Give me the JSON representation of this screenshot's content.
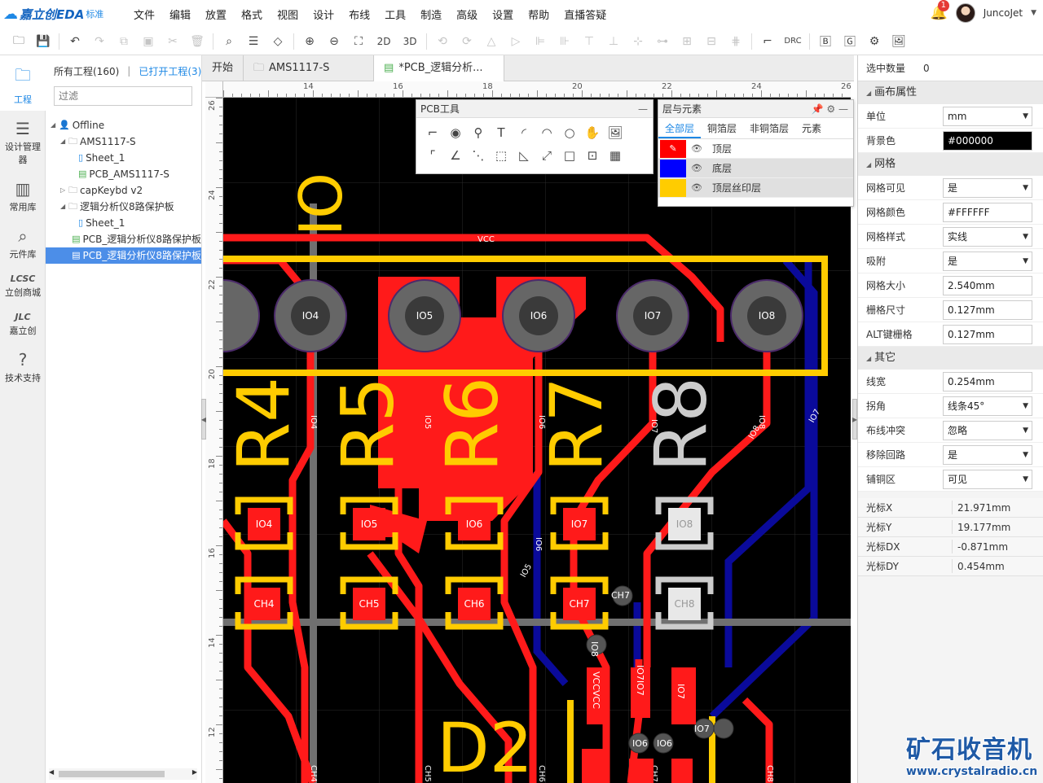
{
  "app": {
    "brand": "嘉立创EDA",
    "edition": "标准"
  },
  "menu": [
    "文件",
    "编辑",
    "放置",
    "格式",
    "视图",
    "设计",
    "布线",
    "工具",
    "制造",
    "高级",
    "设置",
    "帮助",
    "直播答疑"
  ],
  "user": {
    "notifications": "1",
    "name": "JuncoJet"
  },
  "toolbar": {
    "view_2d": "2D",
    "view_3d": "3D",
    "drc": "DRC"
  },
  "rail": [
    {
      "icon": "folder-icon",
      "label": "工程"
    },
    {
      "icon": "list-icon",
      "label": "设计管理器"
    },
    {
      "icon": "chip-icon",
      "label": "常用库"
    },
    {
      "icon": "search-icon",
      "label": "元件库"
    },
    {
      "icon": "lcsc-icon",
      "label": "立创商城"
    },
    {
      "icon": "jlc-icon",
      "label": "嘉立创"
    },
    {
      "icon": "help-icon",
      "label": "技术支持"
    }
  ],
  "projects": {
    "all_label": "所有工程(160)",
    "open_label": "已打开工程(3)",
    "filter_placeholder": "过滤",
    "tree": [
      {
        "level": 0,
        "kind": "user",
        "label": "Offline",
        "expanded": true
      },
      {
        "level": 1,
        "kind": "folder",
        "label": "AMS1117-S",
        "expanded": true
      },
      {
        "level": 2,
        "kind": "sheet",
        "label": "Sheet_1"
      },
      {
        "level": 2,
        "kind": "pcb",
        "label": "PCB_AMS1117-S"
      },
      {
        "level": 1,
        "kind": "folder",
        "label": "capKeybd v2",
        "expanded": false
      },
      {
        "level": 1,
        "kind": "folder",
        "label": "逻辑分析仪8路保护板",
        "expanded": true
      },
      {
        "level": 2,
        "kind": "sheet",
        "label": "Sheet_1"
      },
      {
        "level": 2,
        "kind": "pcb",
        "label": "PCB_逻辑分析仪8路保护板"
      },
      {
        "level": 2,
        "kind": "pcb",
        "label": "PCB_逻辑分析仪8路保护板",
        "selected": true
      }
    ]
  },
  "tabs": [
    {
      "label": "开始",
      "icon": ""
    },
    {
      "label": "AMS1117-S",
      "icon": "folder-icon"
    },
    {
      "label": "*PCB_逻辑分析...",
      "icon": "pcb-icon",
      "active": true
    }
  ],
  "ruler": {
    "h": [
      "14",
      "16",
      "18",
      "20",
      "22",
      "24",
      "26"
    ],
    "v": [
      "26",
      "24",
      "22",
      "20",
      "18",
      "16",
      "14",
      "12"
    ]
  },
  "pcb": {
    "silk": [
      "IO",
      "R4",
      "R5",
      "R6",
      "R7",
      "R8",
      "D2"
    ],
    "pads_top": [
      "IO4",
      "IO5",
      "IO6",
      "IO7",
      "IO8"
    ],
    "io_pads": [
      "IO4",
      "IO5",
      "IO6",
      "IO7",
      "IO8"
    ],
    "ch_pads": [
      "CH4",
      "CH5",
      "CH6",
      "CH7",
      "CH8"
    ],
    "net_vcc": "VCC",
    "net_labels": [
      "IO4",
      "IO5",
      "IO6",
      "IO7",
      "IO8",
      "IO7",
      "IO8",
      "IO6",
      "IO5",
      "CH4",
      "CH5",
      "CH6",
      "CH7",
      "CH8",
      "IO8IO8",
      "VCCVCC",
      "IO7IO7",
      "IO7",
      "IO7",
      "IO6",
      "IO6",
      "IO8",
      "CH7"
    ]
  },
  "pcb_tools": {
    "title": "PCB工具"
  },
  "layers": {
    "title": "层与元素",
    "tabs": [
      "全部层",
      "铜箔层",
      "非铜箔层",
      "元素"
    ],
    "rows": [
      {
        "name": "顶层",
        "color": "#ff0000",
        "active": true
      },
      {
        "name": "底层",
        "color": "#0000ff"
      },
      {
        "name": "顶层丝印层",
        "color": "#ffcc00"
      }
    ]
  },
  "props": {
    "sel_label": "选中数量",
    "sel_value": "0",
    "canvas_title": "画布属性",
    "unit": {
      "label": "单位",
      "value": "mm"
    },
    "bg": {
      "label": "背景色",
      "value": "#000000"
    },
    "grid_title": "网格",
    "grid_visible": {
      "label": "网格可见",
      "value": "是"
    },
    "grid_color": {
      "label": "网格颜色",
      "value": "#FFFFFF"
    },
    "grid_style": {
      "label": "网格样式",
      "value": "实线"
    },
    "snap": {
      "label": "吸附",
      "value": "是"
    },
    "grid_size": {
      "label": "网格大小",
      "value": "2.540mm"
    },
    "grid_dim": {
      "label": "栅格尺寸",
      "value": "0.127mm"
    },
    "alt_grid": {
      "label": "ALT键栅格",
      "value": "0.127mm"
    },
    "other_title": "其它",
    "line_width": {
      "label": "线宽",
      "value": "0.254mm"
    },
    "corner": {
      "label": "拐角",
      "value": "线条45°"
    },
    "conflict": {
      "label": "布线冲突",
      "value": "忽略"
    },
    "remove_loop": {
      "label": "移除回路",
      "value": "是"
    },
    "copper": {
      "label": "铺铜区",
      "value": "可见"
    }
  },
  "cursor": {
    "x": {
      "label": "光标X",
      "value": "21.971mm"
    },
    "y": {
      "label": "光标Y",
      "value": "19.177mm"
    },
    "dx": {
      "label": "光标DX",
      "value": "-0.871mm"
    },
    "dy": {
      "label": "光标DY",
      "value": "0.454mm"
    }
  },
  "watermark": {
    "title": "矿石收音机",
    "url": "www.crystalradio.cn"
  },
  "colors": {
    "accent": "#1e88e5",
    "top_copper": "#ff0000",
    "bottom_copper": "#0000a0",
    "silk": "#ffcc00",
    "pad_gray": "#606060"
  }
}
